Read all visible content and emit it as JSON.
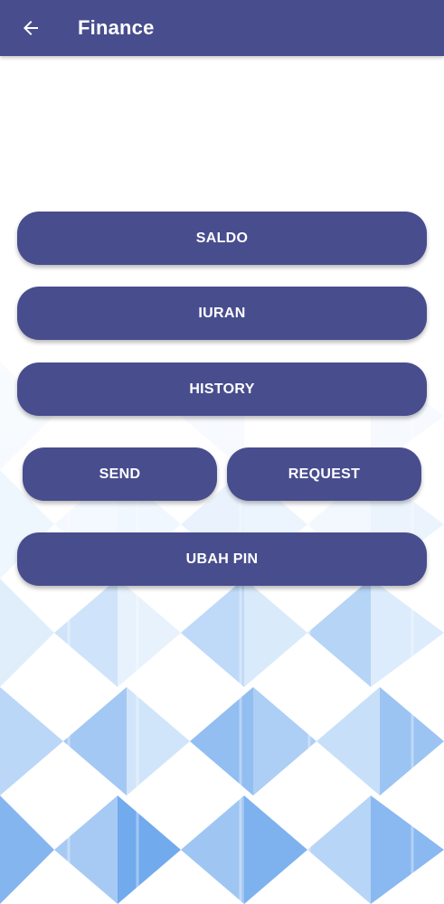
{
  "appbar": {
    "title": "Finance",
    "back_icon": "arrow-left-icon",
    "color": "#484d8e"
  },
  "menu": {
    "saldo_label": "SALDO",
    "iuran_label": "IURAN",
    "history_label": "HISTORY",
    "send_label": "SEND",
    "request_label": "REQUEST",
    "ubah_pin_label": "UBAH PIN"
  },
  "theme": {
    "button_color": "#484d8e",
    "button_text_color": "#ffffff",
    "background_pattern": "blue-geometric-triangles"
  }
}
